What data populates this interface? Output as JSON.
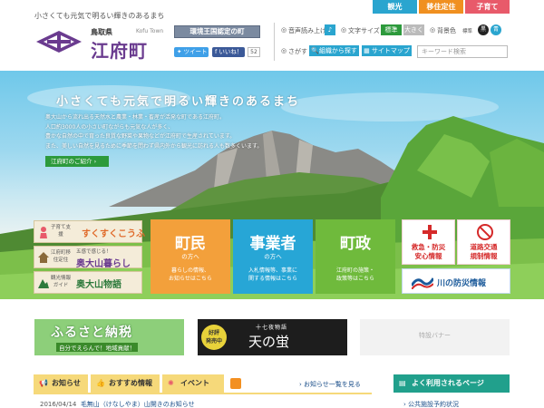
{
  "top_nav": {
    "tourism": "観光",
    "migrate": "移住定住",
    "child": "子育て"
  },
  "header": {
    "tagline": "小さくても元気で明るい輝きのあるまち",
    "prefecture": "鳥取県",
    "town": "江府町",
    "town_en": "Kofu Town",
    "certified": "環境王国認定の町",
    "tweet": "ツイート",
    "like": "いいね！",
    "like_count": "52"
  },
  "tools": {
    "speech_label": "音声読み上げ",
    "font_label": "文字サイズ",
    "font_normal": "標準",
    "font_large": "大きく",
    "bg_label": "背景色",
    "bg_normal": "標準",
    "bg_black": "黒",
    "bg_blue": "青",
    "find_label": "さがす",
    "find_org": "組織から探す",
    "sitemap": "サイトマップ",
    "search_placeholder": "キーワード検索"
  },
  "hero": {
    "title": "小さくても元気で明るい輝きのあるまち",
    "lines": [
      "奥大山から流れ出る天然水と農業・林業・畜産が活発な町である江府町。",
      "人口約3000人の小さい町ながらも元気な人が多く、",
      "豊かな自然の中で育った良質な野菜や果物などが江府町で生産されています。",
      "また、美しい自然を見るために季節を問わず県内外から観光に訪れる人も数多くいます。"
    ],
    "intro_link": "江府町のご紹介"
  },
  "side_buttons": [
    {
      "small": "子育て支援",
      "big": "すくすくこうふ"
    },
    {
      "small": "江府町移住定住",
      "small2": "五感で感じる！",
      "big": "奥大山暮らし"
    },
    {
      "small": "観光情報ガイド",
      "big": "奥大山物語"
    }
  ],
  "tiles": [
    {
      "title": "町民",
      "sub": "の方へ",
      "desc1": "暮らしの情報、",
      "desc2": "お知らせはこちら"
    },
    {
      "title": "事業者",
      "sub": "の方へ",
      "desc1": "入札情報等、事業に",
      "desc2": "関する情報はこちら"
    },
    {
      "title": "町政",
      "sub": "",
      "desc1": "江府町の施策・",
      "desc2": "政策等はこちら"
    }
  ],
  "emergency": {
    "safety_line1": "救急・防災",
    "safety_line2": "安心情報",
    "traffic_line1": "道路交通",
    "traffic_line2": "規制情報",
    "river": "川の防災情報"
  },
  "banners": {
    "furusato_title": "ふるさと納税",
    "furusato_sub": "自分でえらんで！地域貢献！",
    "hotaru_badge1": "好評",
    "hotaru_badge2": "発売中",
    "hotaru_small": "十七夜物語",
    "hotaru_title": "天の蛍",
    "special": "特設バナー"
  },
  "news": {
    "tab_news": "お知らせ",
    "tab_recommend": "おすすめ情報",
    "tab_event": "イベント",
    "list_link": "お知らせ一覧を見る",
    "item_date": "2016/04/14",
    "item_title": "毛無山（けなしやま）山開きのお知らせ"
  },
  "frequent": {
    "title": "よく利用されるページ",
    "item": "公共施設予約状況"
  },
  "colors": {
    "purple": "#6a3b8f",
    "tourism": "#2aa5cf",
    "migrate": "#f09020",
    "child": "#e85a6a",
    "resident": "#f3a03b",
    "business": "#27a6d6",
    "gov": "#6fba3c"
  }
}
